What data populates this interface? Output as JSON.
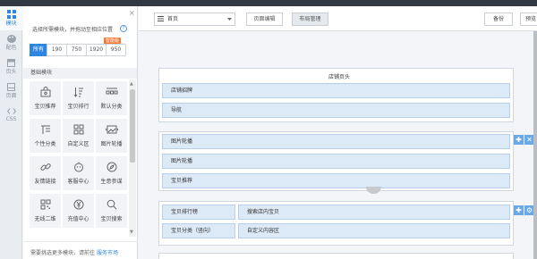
{
  "sidebar": {
    "items": [
      {
        "label": "模块",
        "icon": "grid-icon",
        "active": true
      },
      {
        "label": "配色",
        "icon": "palette-icon",
        "active": false
      },
      {
        "label": "页头",
        "icon": "page-header-icon",
        "active": false
      },
      {
        "label": "页面",
        "icon": "page-icon",
        "active": false
      },
      {
        "label": "CSS",
        "icon": "code-icon",
        "active": false
      }
    ]
  },
  "panel": {
    "close": "×",
    "hint": "选择所需模块，并拖动至相应位置",
    "help": "?",
    "width_tabs": [
      "所有",
      "190",
      "750",
      "1920",
      "950"
    ],
    "smart_badge": "智能版",
    "section_title": "基础模块",
    "modules": [
      {
        "label": "宝贝推荐",
        "icon": "bag-icon"
      },
      {
        "label": "宝贝排行",
        "icon": "sort-icon"
      },
      {
        "label": "默认分类",
        "icon": "category-icon"
      },
      {
        "label": "个性分类",
        "icon": "custom-category-icon"
      },
      {
        "label": "自定义区",
        "icon": "custom-area-icon"
      },
      {
        "label": "图片轮播",
        "icon": "carousel-icon"
      },
      {
        "label": "友情链接",
        "icon": "link-icon"
      },
      {
        "label": "客服中心",
        "icon": "service-icon"
      },
      {
        "label": "生意参谋",
        "icon": "compass-icon"
      },
      {
        "label": "无线二维",
        "icon": "qrcode-icon"
      },
      {
        "label": "充值中心",
        "icon": "yen-icon"
      },
      {
        "label": "宝贝搜索",
        "icon": "search-icon"
      }
    ],
    "footer_text": "需要挑选更多模块，请前往",
    "footer_link": "服务市场"
  },
  "toolbar": {
    "page_select": "首页",
    "tabs": [
      {
        "label": "页面编辑",
        "active": false
      },
      {
        "label": "布局管理",
        "active": true
      }
    ],
    "backup": "备份",
    "preview": "预览"
  },
  "canvas": {
    "header_section_title": "店铺页头",
    "header_modules": [
      "店铺招牌",
      "导航"
    ],
    "section2_modules": [
      "图片轮播",
      "图片轮播",
      "宝贝推荐"
    ],
    "section3_rows": [
      {
        "left": "宝贝排行榜",
        "right": "搜索店内宝贝"
      },
      {
        "left": "宝贝分类（竖向）",
        "right": "自定义内容区"
      }
    ],
    "tools": {
      "move": "✚",
      "delete": "✕",
      "settings": "⚙"
    }
  },
  "colors": {
    "accent": "#2f86e0",
    "module_bar": "#dce9f7",
    "badge": "#f07b38",
    "topbar": "#333944"
  }
}
